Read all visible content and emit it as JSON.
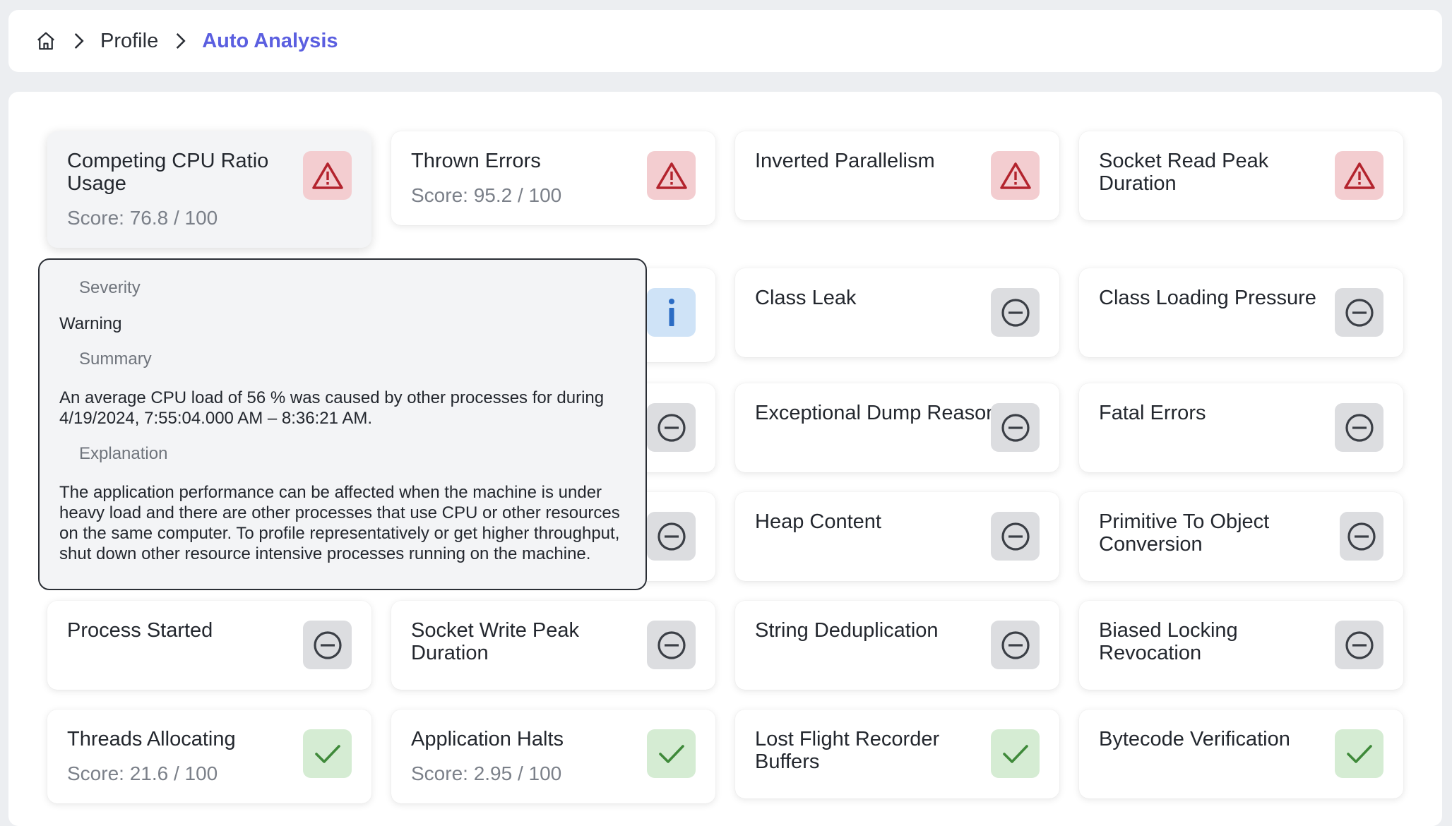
{
  "breadcrumb": {
    "home_icon": "home-icon",
    "items": [
      "Profile",
      "Auto Analysis"
    ]
  },
  "colors": {
    "accent": "#5b5fe0",
    "warning_bg": "#f3cdd0",
    "warning_fg": "#b3232d",
    "info_bg": "#cfe3f7",
    "info_fg": "#2b6cc4",
    "neutral_bg": "#dcdde0",
    "neutral_fg": "#3b3f46",
    "ok_bg": "#d5ecd3",
    "ok_fg": "#3f8a3a"
  },
  "cards": [
    {
      "title": "Competing CPU Ratio Usage",
      "score": "Score: 76.8 / 100",
      "status": "warning",
      "icon": "warning-triangle-icon"
    },
    {
      "title": "Thrown Errors",
      "score": "Score: 95.2 / 100",
      "status": "warning",
      "icon": "warning-triangle-icon"
    },
    {
      "title": "Inverted Parallelism",
      "score": "",
      "status": "warning",
      "icon": "warning-triangle-icon"
    },
    {
      "title": "Socket Read Peak Duration",
      "score": "",
      "status": "warning",
      "icon": "warning-triangle-icon"
    },
    {
      "title": "",
      "score": "",
      "status": "info",
      "icon": "info-icon"
    },
    {
      "title": "Class Leak",
      "score": "",
      "status": "neutral",
      "icon": "minus-circle-icon"
    },
    {
      "title": "Class Loading Pressure",
      "score": "",
      "status": "neutral",
      "icon": "minus-circle-icon"
    },
    {
      "title": "",
      "score": "",
      "status": "neutral",
      "icon": "minus-circle-icon"
    },
    {
      "title": "Exceptional Dump Reason",
      "score": "",
      "status": "neutral",
      "icon": "minus-circle-icon"
    },
    {
      "title": "Fatal Errors",
      "score": "",
      "status": "neutral",
      "icon": "minus-circle-icon"
    },
    {
      "title": "",
      "score": "",
      "status": "neutral",
      "icon": "minus-circle-icon"
    },
    {
      "title": "Heap Content",
      "score": "",
      "status": "neutral",
      "icon": "minus-circle-icon"
    },
    {
      "title": "Primitive To Object Conversion",
      "score": "",
      "status": "neutral",
      "icon": "minus-circle-icon"
    },
    {
      "title": "Process Started",
      "score": "",
      "status": "neutral",
      "icon": "minus-circle-icon"
    },
    {
      "title": "Socket Write Peak Duration",
      "score": "",
      "status": "neutral",
      "icon": "minus-circle-icon"
    },
    {
      "title": "String Deduplication",
      "score": "",
      "status": "neutral",
      "icon": "minus-circle-icon"
    },
    {
      "title": "Biased Locking Revocation",
      "score": "",
      "status": "neutral",
      "icon": "minus-circle-icon"
    },
    {
      "title": "Threads Allocating",
      "score": "Score: 21.6 / 100",
      "status": "ok",
      "icon": "check-icon"
    },
    {
      "title": "Application Halts",
      "score": "Score: 2.95 / 100",
      "status": "ok",
      "icon": "check-icon"
    },
    {
      "title": "Lost Flight Recorder Buffers",
      "score": "",
      "status": "ok",
      "icon": "check-icon"
    },
    {
      "title": "Bytecode Verification",
      "score": "",
      "status": "ok",
      "icon": "check-icon"
    }
  ],
  "tooltip": {
    "severity_label": "Severity",
    "severity_value": "Warning",
    "summary_label": "Summary",
    "summary_text": "An average CPU load of 56 % was caused by other processes for during 4/19/2024, 7:55:04.000 AM – 8:36:21 AM.",
    "explanation_label": "Explanation",
    "explanation_text": "The application performance can be affected when the machine is under heavy load and there are other processes that use CPU or other resources on the same computer. To profile representatively or get higher throughput, shut down other resource intensive processes running on the machine."
  }
}
